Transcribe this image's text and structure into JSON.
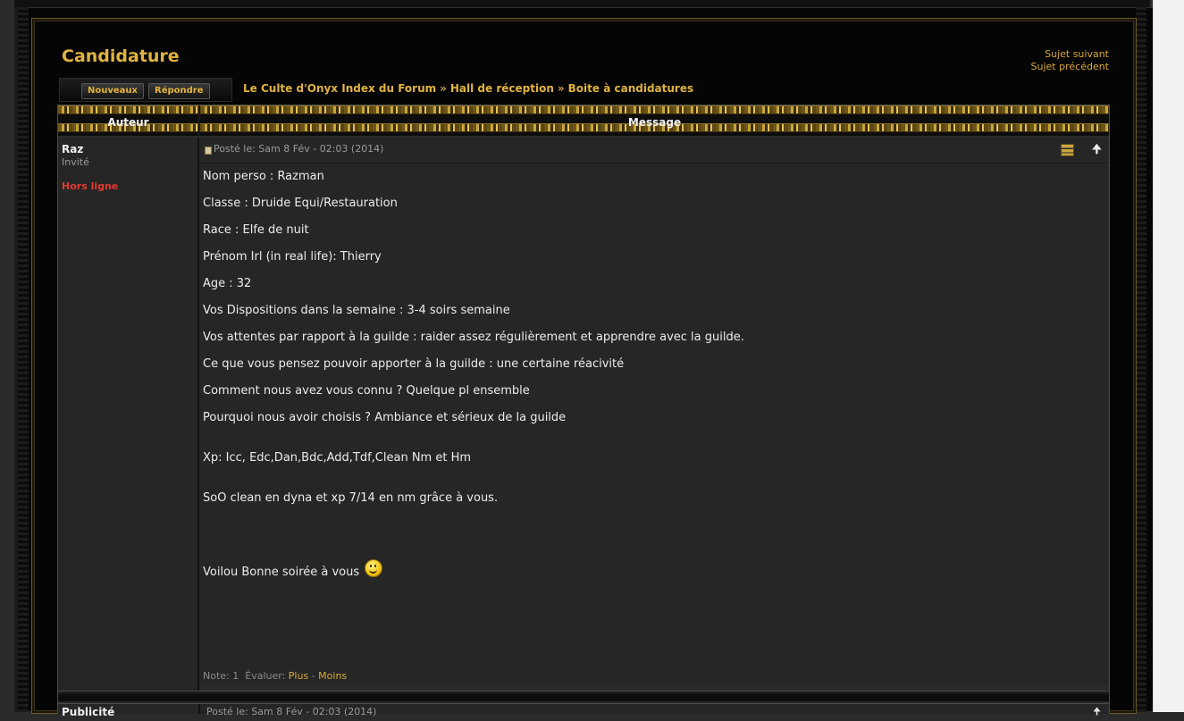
{
  "page": {
    "title": "Candidature",
    "next_topic": "Sujet suivant",
    "prev_topic": "Sujet précédent"
  },
  "buttons": {
    "new": "Nouveaux",
    "reply": "Répondre"
  },
  "breadcrumb": [
    "Le Culte d'Onyx Index du Forum",
    "Hall de réception",
    "Boite à candidatures"
  ],
  "breadcrumb_sep": "»",
  "table_headers": {
    "author": "Auteur",
    "message": "Message"
  },
  "post": {
    "author": "Raz",
    "rank": "Invité",
    "status": "Hors ligne",
    "date": "Posté le: Sam 8 Fév - 02:03 (2014)",
    "lines": [
      "Nom perso : Razman",
      "Classe : Druide Equi/Restauration",
      "Race : Elfe de nuit",
      "Prénom Irl (in real life): Thierry",
      "Age : 32",
      "Vos Dispositions dans la semaine : 3-4 soirs semaine",
      "Vos attentes par rapport à la guilde : raider assez régulièrement et apprendre avec la guilde.",
      "Ce que vous pensez pouvoir apporter à la guilde :  une certaine réacivité",
      "Comment nous avez vous connu ? Quelque pl ensemble",
      "Pourquoi nous avoir choisis ? Ambiance et sérieux de la guilde",
      "Xp: Icc, Edc,Dan,Bdc,Add,Tdf,Clean Nm et Hm",
      "SoO clean en dyna et xp 7/14 en nm grâce à vous.",
      "Voilou Bonne soirée à vous"
    ],
    "rating": {
      "note": "Note: 1",
      "evaluate": "Évaluer:",
      "plus": "Plus",
      "dash": "-",
      "minus": "Moins"
    }
  },
  "second_row": {
    "author": "Publicité",
    "date": "Posté le: Sam 8 Fév - 02:03 (2014)"
  },
  "icons": [
    "post-icon",
    "quote-icon",
    "arrow-up-icon",
    "smiley-icon"
  ]
}
